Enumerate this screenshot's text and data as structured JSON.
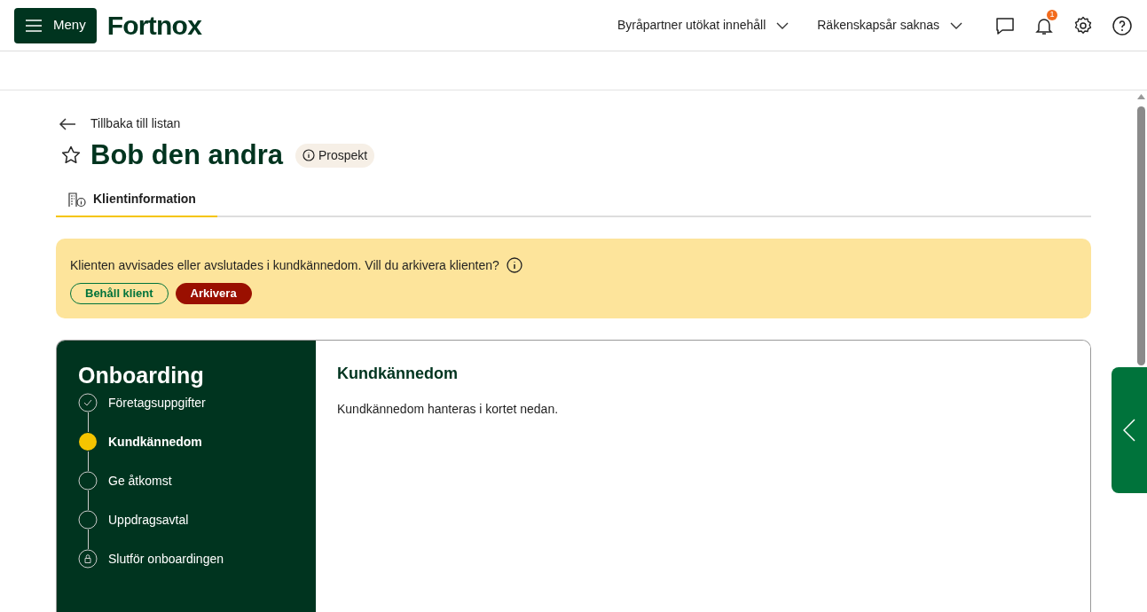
{
  "header": {
    "menu_button": "Meny",
    "logo": "Fortnox",
    "dropdowns": [
      "Byråpartner utökat innehåll",
      "Räkenskapsår saknas"
    ],
    "notification_count": "1"
  },
  "back_link": "Tillbaka till listan",
  "client": {
    "name": "Bob den andra",
    "favorite": false,
    "status": "Prospekt"
  },
  "tabs": [
    {
      "label": "Klientinformation",
      "selected": true
    }
  ],
  "alert": {
    "message": "Klienten avvisades eller avslutades i kundkännedom. Vill du arkivera klienten?",
    "buttons": [
      {
        "label": "Behåll klient",
        "kind": "secondary"
      },
      {
        "label": "Arkivera",
        "kind": "danger"
      }
    ]
  },
  "onboarding": {
    "title": "Onboarding",
    "steps": [
      {
        "label": "Företagsuppgifter",
        "kind": "done"
      },
      {
        "label": "Kundkännedom",
        "kind": "current"
      },
      {
        "label": "Ge åtkomst",
        "kind": "todo"
      },
      {
        "label": "Uppdragsavtal",
        "kind": "todo"
      },
      {
        "label": "Slutför onboardingen",
        "kind": "locked"
      }
    ]
  },
  "detail": {
    "title": "Kundkännedom",
    "text": "Kundkännedom hanteras i kortet nedan."
  }
}
